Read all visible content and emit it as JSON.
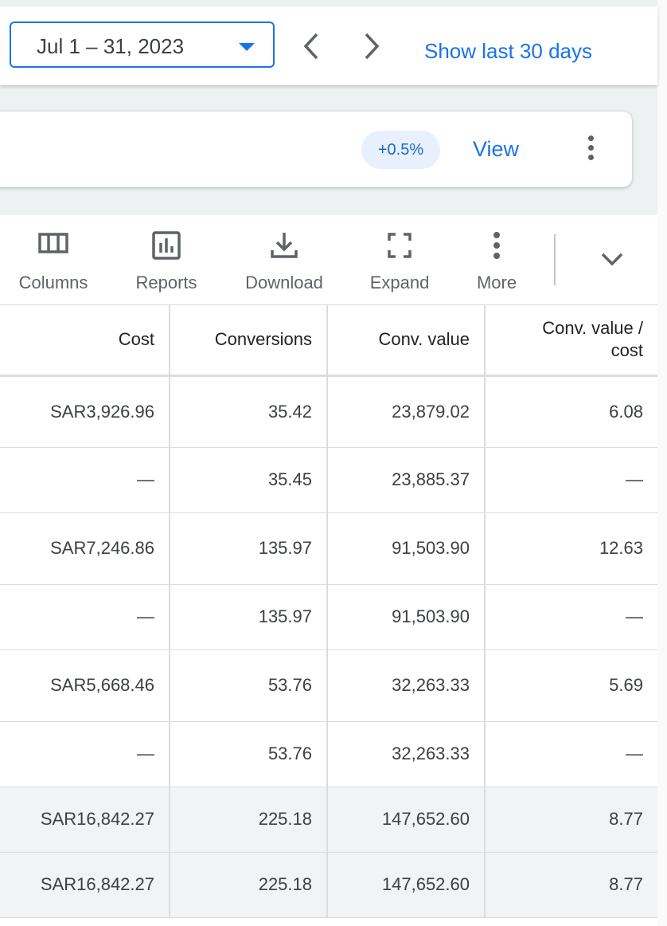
{
  "date_bar": {
    "range": "Jul 1 – 31, 2023",
    "show_last": "Show last 30 days"
  },
  "card": {
    "change": "+0.5%",
    "view": "View"
  },
  "toolbar": {
    "columns": "Columns",
    "reports": "Reports",
    "download": "Download",
    "expand": "Expand",
    "more": "More"
  },
  "table": {
    "headers": {
      "cost": "Cost",
      "conversions": "Conversions",
      "conv_value": "Conv. value",
      "conv_value_cost_1": "Conv. value /",
      "conv_value_cost_2": "cost"
    },
    "rows": [
      {
        "cost": "SAR3,926.96",
        "conversions": "35.42",
        "conv_value": "23,879.02",
        "ratio": "6.08"
      },
      {
        "cost": "—",
        "conversions": "35.45",
        "conv_value": "23,885.37",
        "ratio": "—"
      },
      {
        "cost": "SAR7,246.86",
        "conversions": "135.97",
        "conv_value": "91,503.90",
        "ratio": "12.63"
      },
      {
        "cost": "—",
        "conversions": "135.97",
        "conv_value": "91,503.90",
        "ratio": "—"
      },
      {
        "cost": "SAR5,668.46",
        "conversions": "53.76",
        "conv_value": "32,263.33",
        "ratio": "5.69"
      },
      {
        "cost": "—",
        "conversions": "53.76",
        "conv_value": "32,263.33",
        "ratio": "—"
      },
      {
        "cost": "SAR16,842.27",
        "conversions": "225.18",
        "conv_value": "147,652.60",
        "ratio": "8.77"
      },
      {
        "cost": "SAR16,842.27",
        "conversions": "225.18",
        "conv_value": "147,652.60",
        "ratio": "8.77"
      }
    ]
  },
  "colors": {
    "accent": "#1a73e8",
    "pill_bg": "#e8f0fe",
    "total_row_bg": "#f1f3f4"
  },
  "icons": [
    "chevron-left-icon",
    "chevron-right-icon",
    "columns-icon",
    "reports-icon",
    "download-icon",
    "expand-icon",
    "more-vert-icon",
    "chevron-down-icon"
  ]
}
